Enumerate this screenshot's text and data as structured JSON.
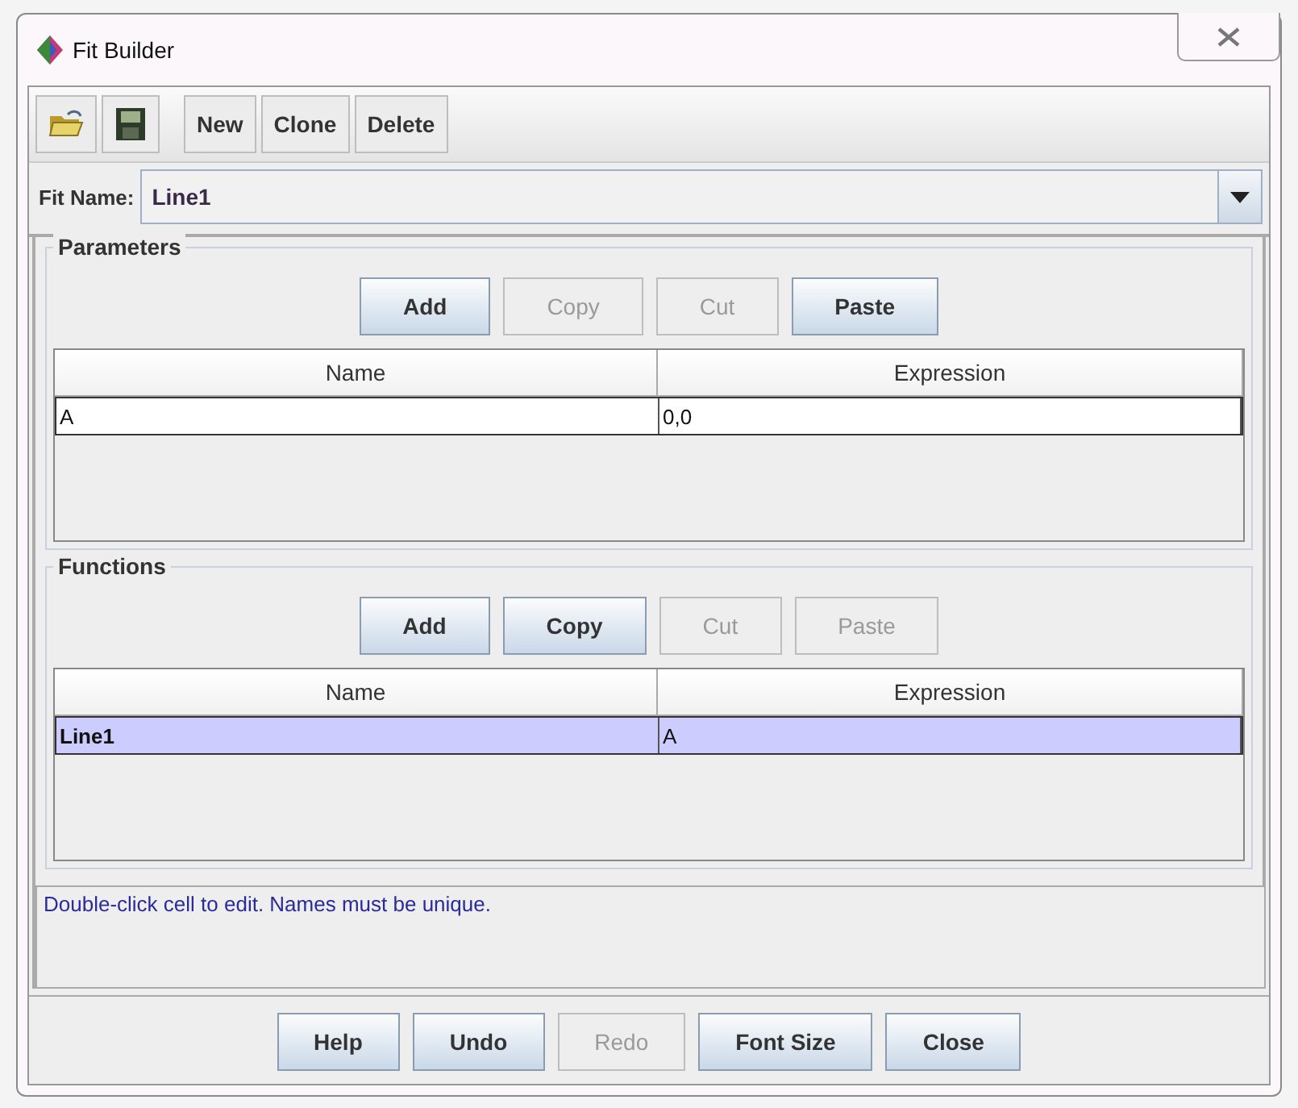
{
  "window": {
    "title": "Fit Builder"
  },
  "toolbar": {
    "icons": [
      {
        "kind": "open"
      },
      {
        "kind": "save"
      }
    ],
    "buttons": [
      "New",
      "Clone",
      "Delete"
    ]
  },
  "fit_name": {
    "label": "Fit Name:",
    "value": "Line1"
  },
  "sections": [
    {
      "title": "Parameters",
      "buttons": [
        {
          "label": "Add",
          "disabled": false
        },
        {
          "label": "Copy",
          "disabled": true
        },
        {
          "label": "Cut",
          "disabled": true
        },
        {
          "label": "Paste",
          "disabled": false
        }
      ],
      "columns": [
        "Name",
        "Expression"
      ],
      "rows": [
        {
          "name": "A",
          "expression": "0,0",
          "selected": false
        }
      ]
    },
    {
      "title": "Functions",
      "buttons": [
        {
          "label": "Add",
          "disabled": false
        },
        {
          "label": "Copy",
          "disabled": false
        },
        {
          "label": "Cut",
          "disabled": true
        },
        {
          "label": "Paste",
          "disabled": true
        }
      ],
      "columns": [
        "Name",
        "Expression"
      ],
      "rows": [
        {
          "name": "Line1",
          "expression": "A",
          "selected": true
        }
      ]
    }
  ],
  "status": "Double-click cell to edit. Names must be unique.",
  "footer_buttons": [
    {
      "label": "Help",
      "disabled": false
    },
    {
      "label": "Undo",
      "disabled": false
    },
    {
      "label": "Redo",
      "disabled": true
    },
    {
      "label": "Font Size",
      "disabled": false
    },
    {
      "label": "Close",
      "disabled": false
    }
  ]
}
